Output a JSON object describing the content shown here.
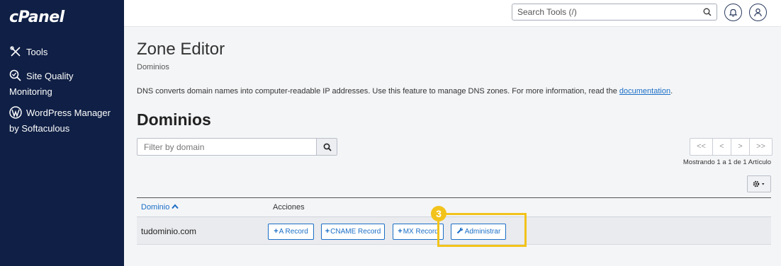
{
  "app": {
    "logo": "cPanel"
  },
  "sidebar": {
    "items": [
      {
        "label": "Tools",
        "icon": "tools-icon"
      },
      {
        "label": "Site Quality Monitoring",
        "icon": "search-quality-icon"
      },
      {
        "label": "WordPress Manager by Softaculous",
        "icon": "wordpress-icon"
      }
    ]
  },
  "header": {
    "search_placeholder": "Search Tools (/)",
    "icons": [
      "search-icon",
      "bell-icon",
      "user-icon"
    ]
  },
  "page": {
    "title": "Zone Editor",
    "breadcrumb": "Dominios",
    "description": "DNS converts domain names into computer-readable IP addresses. Use this feature to manage DNS zones. For more information, read the ",
    "description_link": "documentation",
    "description_end": ".",
    "section_title": "Dominios"
  },
  "filter": {
    "placeholder": "Filter by domain"
  },
  "pagination": {
    "first": "<<",
    "prev": "<",
    "next": ">",
    "last": ">>",
    "showing": "Mostrando 1 a 1 de 1 Artículo"
  },
  "table": {
    "columns": [
      "Dominio",
      "Acciones"
    ],
    "rows": [
      {
        "domain": "tudominio.com",
        "actions": [
          "A Record",
          "CNAME Record",
          "MX Record",
          "Administrar"
        ]
      }
    ]
  },
  "annotation": {
    "step": "3",
    "color": "#f2c31b"
  },
  "colors": {
    "sidebar": "#0f1f45",
    "link": "#1a6ec6"
  }
}
